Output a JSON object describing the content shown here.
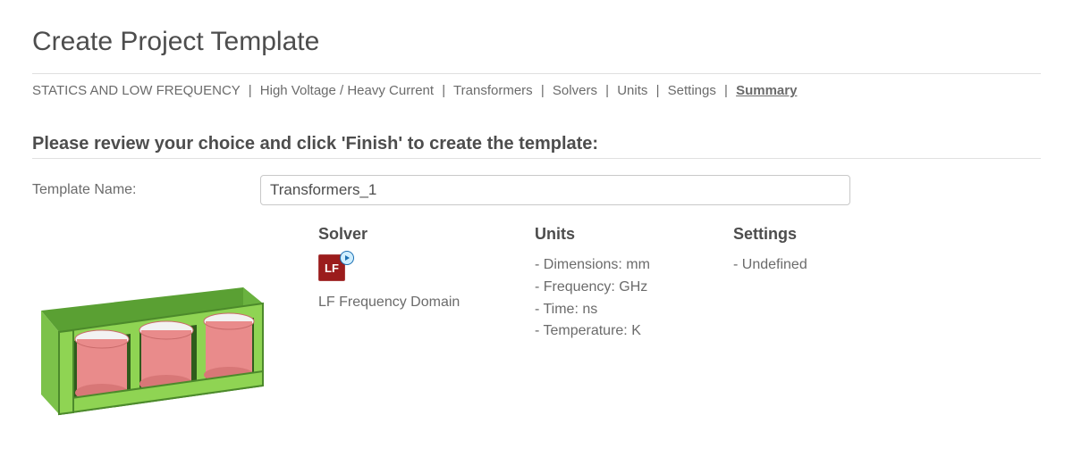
{
  "title": "Create Project Template",
  "breadcrumb": [
    "STATICS AND LOW FREQUENCY",
    "High Voltage / Heavy Current",
    "Transformers",
    "Solvers",
    "Units",
    "Settings",
    "Summary"
  ],
  "subtitle": "Please review your choice and click 'Finish' to create the template:",
  "template_name": {
    "label": "Template Name:",
    "value": "Transformers_1"
  },
  "solver": {
    "heading": "Solver",
    "icon_text": "LF",
    "name": "LF Frequency Domain"
  },
  "units": {
    "heading": "Units",
    "lines": [
      "- Dimensions: mm",
      "- Frequency: GHz",
      "- Time: ns",
      "- Temperature: K"
    ]
  },
  "settings": {
    "heading": "Settings",
    "lines": [
      "- Undefined"
    ]
  }
}
